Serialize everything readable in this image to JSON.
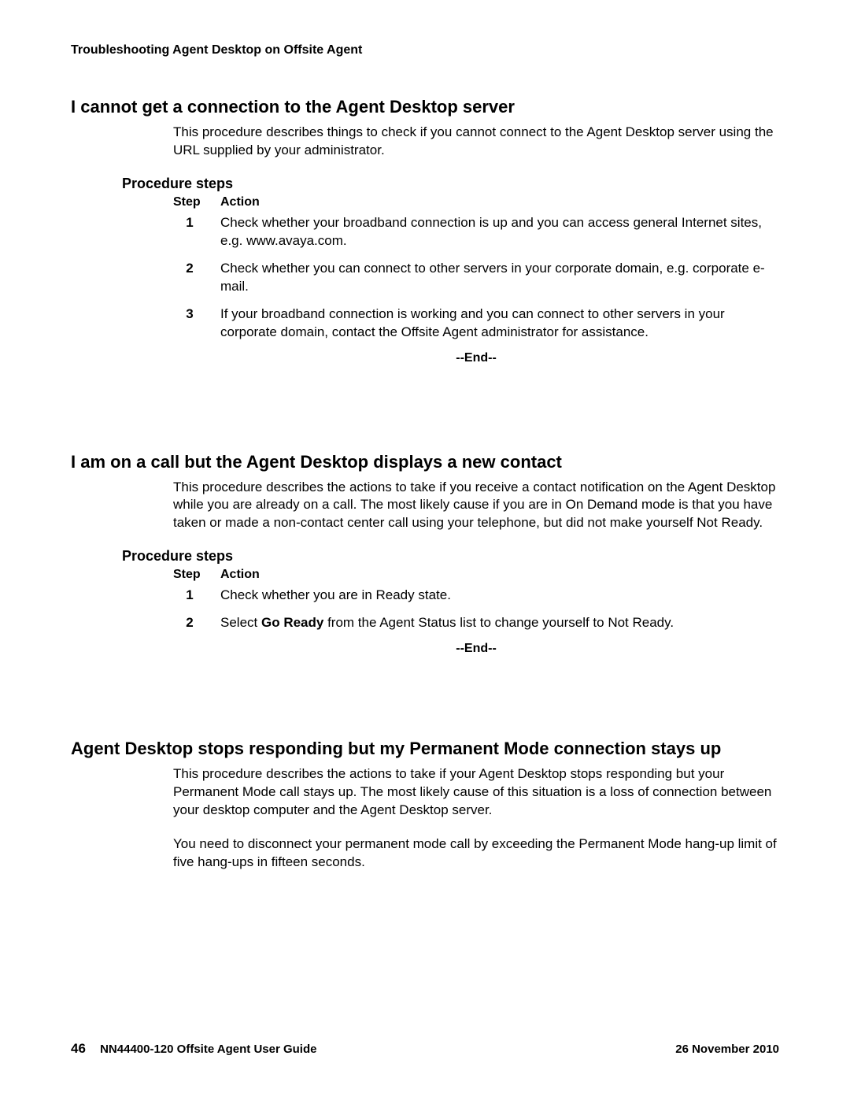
{
  "header": "Troubleshooting Agent Desktop on Offsite Agent",
  "sections": [
    {
      "title": "I cannot get a connection to the Agent Desktop server",
      "body": "This procedure describes things to check if you cannot connect to the Agent Desktop server using the URL supplied by your administrator.",
      "proc_label": "Procedure steps",
      "table_head_step": "Step",
      "table_head_action": "Action",
      "steps": [
        {
          "n": "1",
          "a": "Check whether your broadband connection is up and you can access general Internet sites, e.g. www.avaya.com."
        },
        {
          "n": "2",
          "a": "Check whether you can connect to other servers in your corporate domain, e.g. corporate e-mail."
        },
        {
          "n": "3",
          "a": "If your broadband connection is working and you can connect to other servers in your corporate domain, contact the Offsite Agent administrator for assistance."
        }
      ],
      "end": "--End--"
    },
    {
      "title": "I am on a call but the Agent Desktop displays a new contact",
      "body": "This procedure describes the actions to take if you receive a contact notification on the Agent Desktop while you are already on a call. The most likely cause if you are in On Demand mode is that you have taken or made a non-contact center call using your telephone, but did not make yourself Not Ready.",
      "proc_label": "Procedure steps",
      "table_head_step": "Step",
      "table_head_action": "Action",
      "steps": [
        {
          "n": "1",
          "a": "Check whether you are in Ready state."
        },
        {
          "n": "2",
          "a_pre": "Select ",
          "a_bold": "Go Ready",
          "a_post": " from the Agent Status list to change yourself to Not Ready."
        }
      ],
      "end": "--End--"
    },
    {
      "title": "Agent Desktop stops responding but my Permanent Mode connection stays up",
      "body1": "This procedure describes the actions to take if your Agent Desktop stops responding but your Permanent Mode call stays up. The most likely cause of this situation is a loss of connection between your desktop computer and the Agent Desktop server.",
      "body2": "You need to disconnect your permanent mode call by exceeding the Permanent Mode hang-up limit of five hang-ups in fifteen seconds."
    }
  ],
  "footer": {
    "page": "46",
    "doc": "NN44400-120 Offsite Agent User Guide",
    "date": "26 November 2010"
  }
}
